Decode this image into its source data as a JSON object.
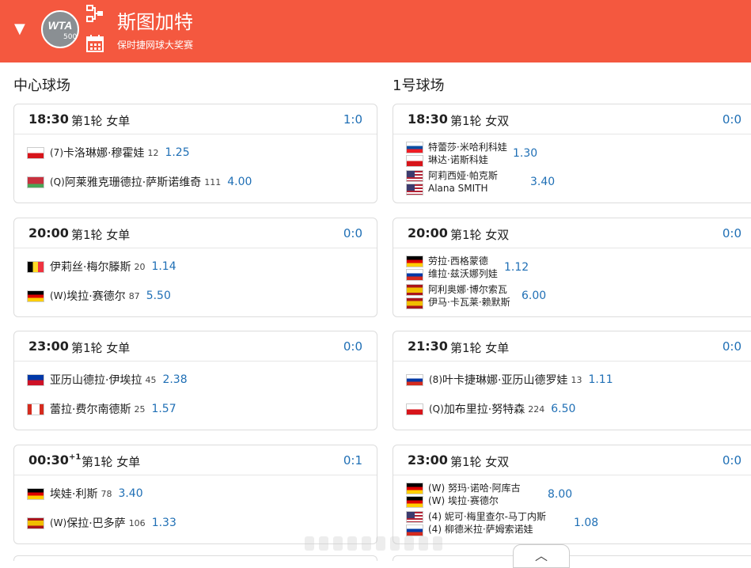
{
  "header": {
    "tour_name": "斯图加特",
    "tour_sub": "保时捷网球大奖赛",
    "logo_text": "WTA",
    "logo_level": "500",
    "bg_color": "#f4583f"
  },
  "courts": [
    {
      "title": "中心球场",
      "matches": [
        {
          "time": "18:30",
          "round": "第1轮 女单",
          "score": "1:0",
          "p1": {
            "seed": "(7)",
            "name": "卡洛琳娜·穆霍娃",
            "rank": "12",
            "odds": "1.25",
            "flag": "cz"
          },
          "p2": {
            "seed": "(Q)",
            "name": "阿莱雅克珊德拉·萨斯诺维奇",
            "rank": "111",
            "odds": "4.00",
            "flag": "by"
          }
        },
        {
          "time": "20:00",
          "round": "第1轮 女单",
          "score": "0:0",
          "p1": {
            "seed": "",
            "name": "伊莉丝·梅尔滕斯",
            "rank": "20",
            "odds": "1.14",
            "flag": "be"
          },
          "p2": {
            "seed": "(W)",
            "name": "埃拉·赛德尔",
            "rank": "87",
            "odds": "5.50",
            "flag": "de"
          }
        },
        {
          "time": "23:00",
          "round": "第1轮 女单",
          "score": "0:0",
          "p1": {
            "seed": "",
            "name": "亚历山德拉·伊埃拉",
            "rank": "45",
            "odds": "2.38",
            "flag": "ph"
          },
          "p2": {
            "seed": "",
            "name": "蕾拉·费尔南德斯",
            "rank": "25",
            "odds": "1.57",
            "flag": "ca"
          }
        },
        {
          "time": "00:30",
          "time_sup": "+1",
          "round": "第1轮 女单",
          "score": "0:1",
          "p1": {
            "seed": "",
            "name": "埃娃·利斯",
            "rank": "78",
            "odds": "3.40",
            "flag": "de"
          },
          "p2": {
            "seed": "(W)",
            "name": "保拉·巴多萨",
            "rank": "106",
            "odds": "1.33",
            "flag": "es"
          }
        }
      ]
    },
    {
      "title": "1号球场",
      "matches": [
        {
          "time": "18:30",
          "round": "第1轮 女双",
          "score": "0:0",
          "doubles": true,
          "t1": {
            "names": [
              "特蕾莎·米哈利科娃",
              "琳达·诺斯科娃"
            ],
            "odds": "1.30",
            "flags": [
              "sk",
              "cz"
            ]
          },
          "t2": {
            "names": [
              "阿莉西娅·帕克斯",
              "Alana SMITH"
            ],
            "odds": "3.40",
            "flags": [
              "us",
              "us"
            ]
          }
        },
        {
          "time": "20:00",
          "round": "第1轮 女双",
          "score": "0:0",
          "doubles": true,
          "t1": {
            "names": [
              "劳拉·西格蒙德",
              "维拉·兹沃娜列娃"
            ],
            "odds": "1.12",
            "flags": [
              "de",
              "ru"
            ]
          },
          "t2": {
            "names": [
              "阿利奥娜·博尔索瓦",
              "伊马·卡瓦莱·赖默斯"
            ],
            "odds": "6.00",
            "flags": [
              "es",
              "es"
            ]
          }
        },
        {
          "time": "21:30",
          "round": "第1轮 女单",
          "score": "0:0",
          "p1": {
            "seed": "(8)",
            "name": "叶卡捷琳娜·亚历山德罗娃",
            "rank": "13",
            "odds": "1.11",
            "flag": "ru"
          },
          "p2": {
            "seed": "(Q)",
            "name": "加布里拉·努特森",
            "rank": "224",
            "odds": "6.50",
            "flag": "cz"
          }
        },
        {
          "time": "23:00",
          "round": "第1轮 女双",
          "score": "0:0",
          "doubles": true,
          "t1": {
            "names": [
              "(W) 努玛·诺哈·阿库古",
              "(W) 埃拉·赛德尔"
            ],
            "odds": "8.00",
            "flags": [
              "de",
              "de"
            ]
          },
          "t2": {
            "names": [
              "(4) 妮可·梅里查尔-马丁内斯",
              "(4) 柳德米拉·萨姆索诺娃"
            ],
            "odds": "1.08",
            "flags": [
              "us",
              "ru"
            ]
          }
        }
      ]
    }
  ],
  "colors": {
    "accent": "#1f6fb5",
    "header": "#f4583f"
  }
}
